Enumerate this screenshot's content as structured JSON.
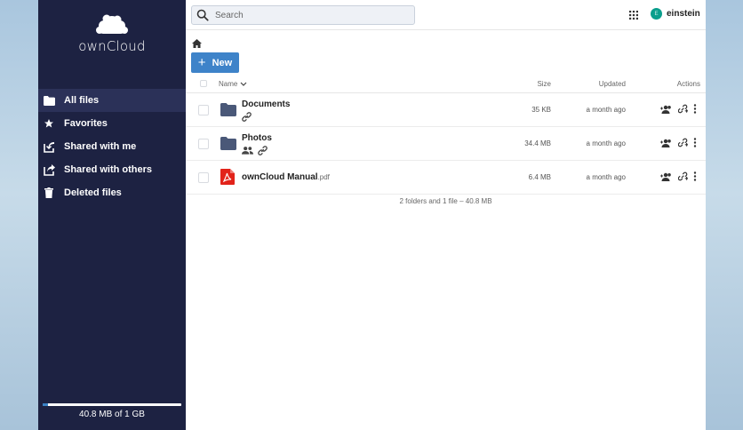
{
  "sidebar": {
    "logo_text": "ownCloud",
    "items": [
      {
        "label": "All files",
        "icon": "folder-icon",
        "active": true
      },
      {
        "label": "Favorites",
        "icon": "star-icon"
      },
      {
        "label": "Shared with me",
        "icon": "shared-in-icon"
      },
      {
        "label": "Shared with others",
        "icon": "shared-out-icon"
      },
      {
        "label": "Deleted files",
        "icon": "trash-icon"
      }
    ],
    "quota": {
      "text": "40.8 MB of 1 GB",
      "used_fraction": 0.04
    }
  },
  "topbar": {
    "search_placeholder": "Search",
    "user": {
      "name": "einstein",
      "initial": "E"
    }
  },
  "toolbar": {
    "new_label": "New"
  },
  "table": {
    "headers": {
      "name": "Name",
      "size": "Size",
      "updated": "Updated",
      "actions": "Actions"
    },
    "rows": [
      {
        "name": "Documents",
        "ext": "",
        "type": "folder",
        "size": "35 KB",
        "updated": "a month ago",
        "badges": [
          "link"
        ]
      },
      {
        "name": "Photos",
        "ext": "",
        "type": "folder",
        "size": "34.4 MB",
        "updated": "a month ago",
        "badges": [
          "people",
          "link"
        ]
      },
      {
        "name": "ownCloud Manual",
        "ext": ".pdf",
        "type": "pdf",
        "size": "6.4 MB",
        "updated": "a month ago",
        "badges": []
      }
    ],
    "summary": "2 folders and 1 file – 40.8 MB"
  },
  "colors": {
    "sidebar": "#1d2242",
    "accent": "#3e83c9",
    "folder": "#4a5878",
    "pdf": "#e2231a"
  }
}
